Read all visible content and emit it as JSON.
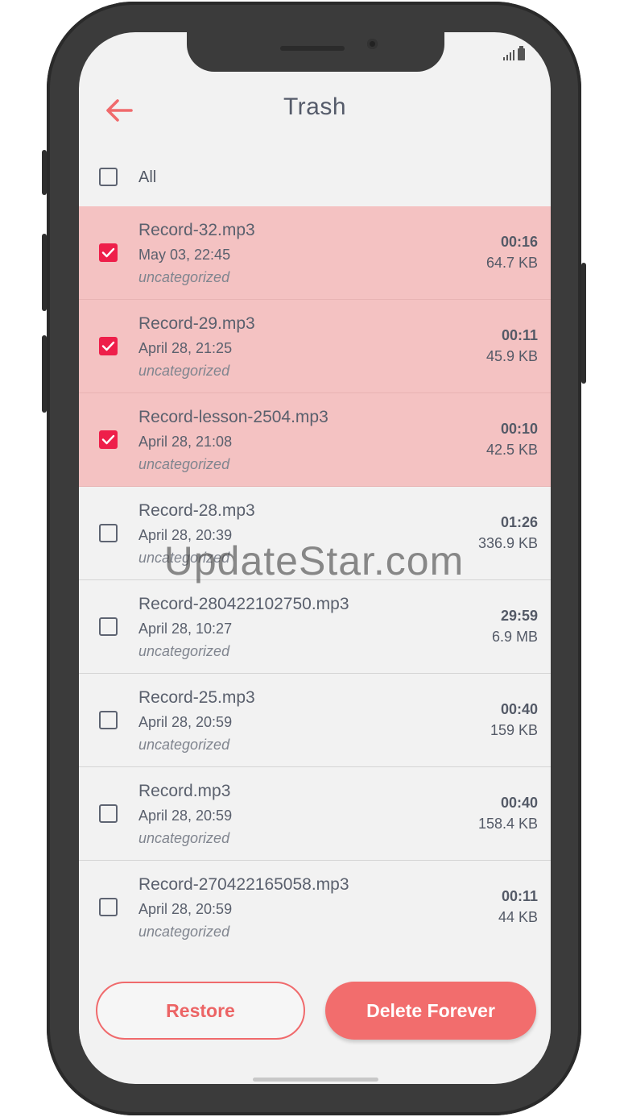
{
  "header": {
    "title": "Trash"
  },
  "select_all": {
    "label": "All",
    "checked": false
  },
  "records": [
    {
      "name": "Record-32.mp3",
      "date": "May 03, 22:45",
      "category": "uncategorized",
      "duration": "00:16",
      "size": "64.7 KB",
      "selected": true
    },
    {
      "name": "Record-29.mp3",
      "date": "April 28, 21:25",
      "category": "uncategorized",
      "duration": "00:11",
      "size": "45.9 KB",
      "selected": true
    },
    {
      "name": "Record-lesson-2504.mp3",
      "date": "April 28, 21:08",
      "category": "uncategorized",
      "duration": "00:10",
      "size": "42.5 KB",
      "selected": true
    },
    {
      "name": "Record-28.mp3",
      "date": "April 28, 20:39",
      "category": "uncategorized",
      "duration": "01:26",
      "size": "336.9 KB",
      "selected": false
    },
    {
      "name": "Record-280422102750.mp3",
      "date": "April 28, 10:27",
      "category": "uncategorized",
      "duration": "29:59",
      "size": "6.9 MB",
      "selected": false
    },
    {
      "name": "Record-25.mp3",
      "date": "April 28, 20:59",
      "category": "uncategorized",
      "duration": "00:40",
      "size": "159 KB",
      "selected": false
    },
    {
      "name": "Record.mp3",
      "date": "April 28, 20:59",
      "category": "uncategorized",
      "duration": "00:40",
      "size": "158.4 KB",
      "selected": false
    },
    {
      "name": "Record-270422165058.mp3",
      "date": "April 28, 20:59",
      "category": "uncategorized",
      "duration": "00:11",
      "size": "44 KB",
      "selected": false
    }
  ],
  "actions": {
    "restore_label": "Restore",
    "delete_label": "Delete Forever"
  },
  "watermark": "UpdateStar.com",
  "colors": {
    "accent": "#F26D6D",
    "selected_row": "#F4C2C2",
    "checkbox_checked": "#EE1F4A",
    "background": "#F2F2F2"
  },
  "icons": {
    "back": "arrow-left-icon",
    "checkbox_checked": "check-icon",
    "signal": "signal-icon",
    "battery": "battery-icon"
  }
}
